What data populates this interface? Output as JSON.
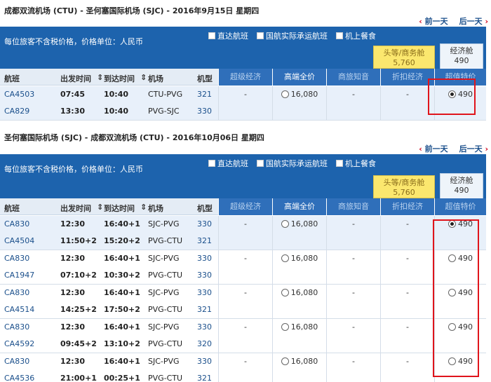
{
  "sections": [
    {
      "route_title": "成都双流机场 (CTU) - 圣何塞国际机场 (SJC) - 2016年9月15日 星期四",
      "prev_day": "前一天",
      "next_day": "后一天",
      "price_note": "每位旅客不含税价格，价格单位：人民币",
      "filters": [
        "直达航班",
        "国航实际承运航班",
        "机上餐食"
      ],
      "cabin_first": {
        "label": "头等/商务舱",
        "price": "5,760"
      },
      "cabin_economy": {
        "label": "经济舱",
        "price": "490"
      },
      "columns": {
        "flight": "航班",
        "depart": "出发时间",
        "arrive": "到达时间",
        "airport": "机场",
        "type": "机型"
      },
      "fares": [
        "超级经济",
        "高端全价",
        "商旅知音",
        "折扣经济",
        "超值特价"
      ],
      "options": [
        {
          "legs": [
            {
              "flight": "CA4503",
              "depart": "07:45",
              "arrive": "10:40",
              "route": "CTU-PVG",
              "aircraft": "321"
            },
            {
              "flight": "CA829",
              "depart": "13:30",
              "arrive": "10:40",
              "route": "PVG-SJC",
              "aircraft": "330"
            }
          ],
          "super_eco": "-",
          "full_price": "16,080",
          "biz_trav": "-",
          "discount": "-",
          "special": "490",
          "selected": true
        }
      ]
    },
    {
      "route_title": "圣何塞国际机场 (SJC) - 成都双流机场 (CTU) - 2016年10月06日 星期四",
      "prev_day": "前一天",
      "next_day": "后一天",
      "price_note": "每位旅客不含税价格，价格单位：人民币",
      "filters": [
        "直达航班",
        "国航实际承运航班",
        "机上餐食"
      ],
      "cabin_first": {
        "label": "头等/商务舱",
        "price": "5,760"
      },
      "cabin_economy": {
        "label": "经济舱",
        "price": "490"
      },
      "columns": {
        "flight": "航班",
        "depart": "出发时间",
        "arrive": "到达时间",
        "airport": "机场",
        "type": "机型"
      },
      "fares": [
        "超级经济",
        "高端全价",
        "商旅知音",
        "折扣经济",
        "超值特价"
      ],
      "options": [
        {
          "legs": [
            {
              "flight": "CA830",
              "depart": "12:30",
              "arrive": "16:40+1",
              "route": "SJC-PVG",
              "aircraft": "330"
            },
            {
              "flight": "CA4504",
              "depart": "11:50+2",
              "arrive": "15:20+2",
              "route": "PVG-CTU",
              "aircraft": "321"
            }
          ],
          "super_eco": "-",
          "full_price": "16,080",
          "biz_trav": "-",
          "discount": "-",
          "special": "490",
          "selected": true
        },
        {
          "legs": [
            {
              "flight": "CA830",
              "depart": "12:30",
              "arrive": "16:40+1",
              "route": "SJC-PVG",
              "aircraft": "330"
            },
            {
              "flight": "CA1947",
              "depart": "07:10+2",
              "arrive": "10:30+2",
              "route": "PVG-CTU",
              "aircraft": "330"
            }
          ],
          "super_eco": "-",
          "full_price": "16,080",
          "biz_trav": "-",
          "discount": "-",
          "special": "490",
          "selected": false
        },
        {
          "legs": [
            {
              "flight": "CA830",
              "depart": "12:30",
              "arrive": "16:40+1",
              "route": "SJC-PVG",
              "aircraft": "330"
            },
            {
              "flight": "CA4514",
              "depart": "14:25+2",
              "arrive": "17:50+2",
              "route": "PVG-CTU",
              "aircraft": "321"
            }
          ],
          "super_eco": "-",
          "full_price": "16,080",
          "biz_trav": "-",
          "discount": "-",
          "special": "490",
          "selected": false
        },
        {
          "legs": [
            {
              "flight": "CA830",
              "depart": "12:30",
              "arrive": "16:40+1",
              "route": "SJC-PVG",
              "aircraft": "330"
            },
            {
              "flight": "CA4592",
              "depart": "09:45+2",
              "arrive": "13:10+2",
              "route": "PVG-CTU",
              "aircraft": "320"
            }
          ],
          "super_eco": "-",
          "full_price": "16,080",
          "biz_trav": "-",
          "discount": "-",
          "special": "490",
          "selected": false
        },
        {
          "legs": [
            {
              "flight": "CA830",
              "depart": "12:30",
              "arrive": "16:40+1",
              "route": "SJC-PVG",
              "aircraft": "330"
            },
            {
              "flight": "CA4536",
              "depart": "21:00+1",
              "arrive": "00:25+1",
              "route": "PVG-CTU",
              "aircraft": "321"
            }
          ],
          "super_eco": "-",
          "full_price": "16,080",
          "biz_trav": "-",
          "discount": "-",
          "special": "490",
          "selected": false
        }
      ]
    }
  ]
}
